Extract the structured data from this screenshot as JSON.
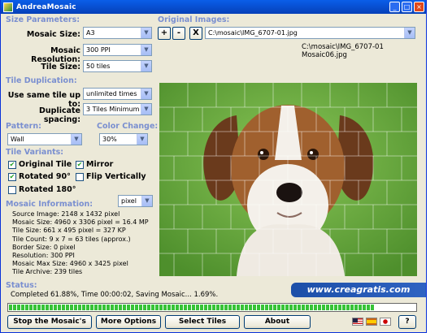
{
  "window": {
    "title": "AndreaMosaic"
  },
  "size_parameters": {
    "heading": "Size Parameters:",
    "mosaic_size": {
      "label": "Mosaic Size:",
      "value": "A3"
    },
    "mosaic_resolution": {
      "label": "Mosaic Resolution:",
      "value": "300 PPI"
    },
    "tile_size": {
      "label": "Tile Size:",
      "value": "50 tiles"
    }
  },
  "tile_duplication": {
    "heading": "Tile Duplication:",
    "same_tile": {
      "label": "Use same tile up to:",
      "value": "unlimited times"
    },
    "duplicate_spacing": {
      "label": "Duplicate spacing:",
      "value": "3 Tiles Minimum"
    }
  },
  "pattern": {
    "heading": "Pattern:",
    "value": "Wall"
  },
  "color_change": {
    "heading": "Color Change:",
    "value": "30%"
  },
  "tile_variants": {
    "heading": "Tile Variants:",
    "original_tile": "Original Tile",
    "mirror": "Mirror",
    "rotated_90": "Rotated 90°",
    "flip_vertically": "Flip Vertically",
    "rotated_180": "Rotated 180°"
  },
  "mosaic_information": {
    "heading": "Mosaic Information:",
    "unit": "pixel",
    "lines": [
      "Source Image: 2148 x 1432 pixel",
      "Mosaic Size: 4960 x 3306 pixel = 16.4 MP",
      "Tile Size: 661 x 495 pixel = 327 KP",
      "Tile Count: 9 x 7 = 63 tiles (approx.)",
      "Border Size: 0 pixel",
      "Resolution: 300 PPI",
      "Mosaic Max Size: 4960 x 3425 pixel",
      "Tile Archive: 239 tiles"
    ]
  },
  "original_images": {
    "heading": "Original Images:",
    "add": "+",
    "remove": "-",
    "clear": "X",
    "path": "C:\\mosaic\\IMG_6707-01.jpg",
    "output_name": "C:\\mosaic\\IMG_6707-01 Mosaic06.jpg"
  },
  "status": {
    "heading": "Status:",
    "text": "Completed 61.88%, Time 00:00:02, Saving Mosaic... 1.69%.",
    "progress": 0.9
  },
  "watermark": "www.creagratis.com",
  "buttons": {
    "stop": "Stop the Mosaic's",
    "more_options": "More Options",
    "select_tiles": "Select Tiles",
    "about": "About",
    "help": "?"
  },
  "colors": {
    "heading": "#7a8fd0",
    "progress": "#37c337",
    "title_bar": "#0852d6"
  }
}
